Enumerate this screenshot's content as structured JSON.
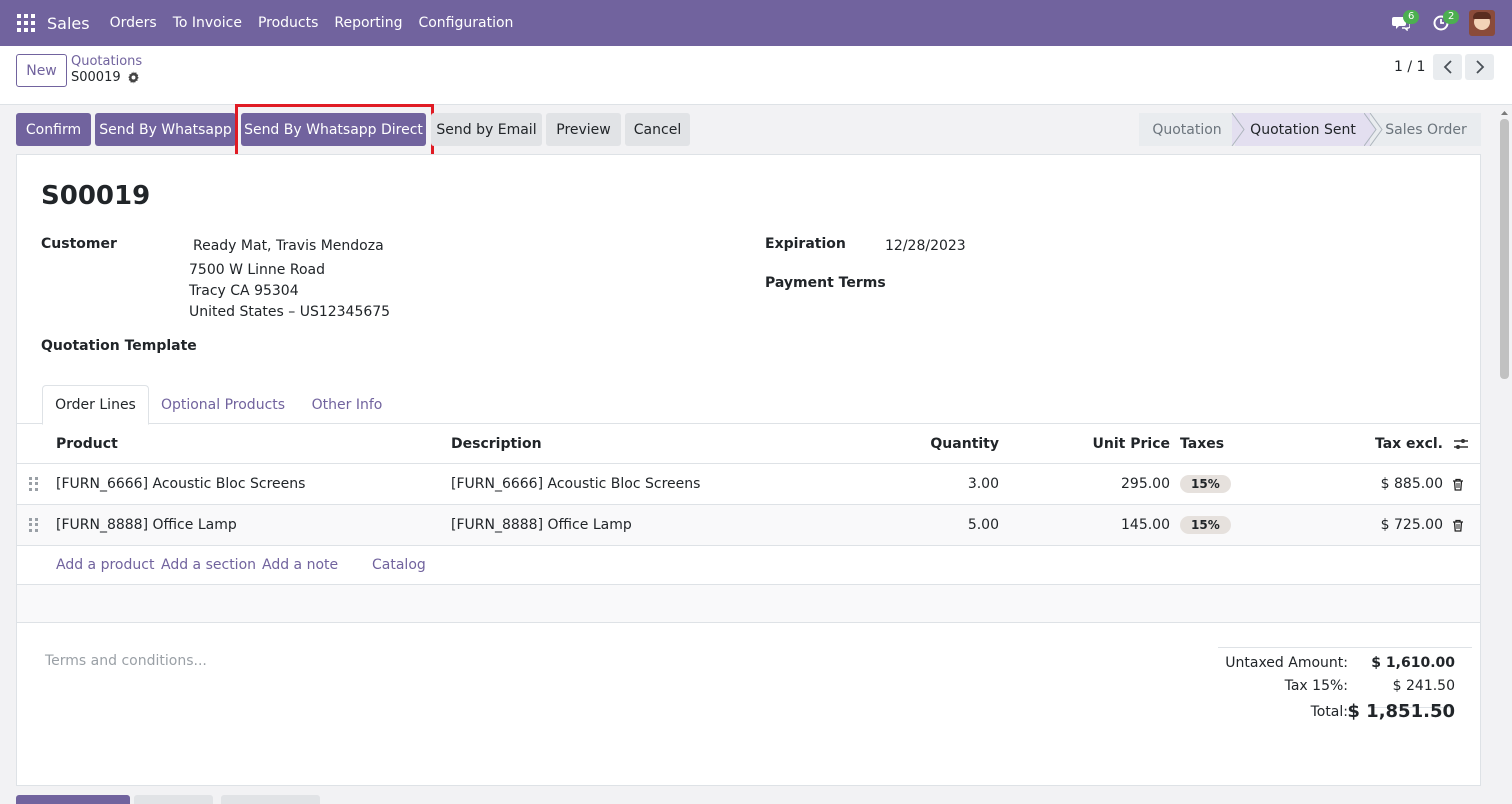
{
  "navbar": {
    "app_name": "Sales",
    "menus": [
      "Orders",
      "To Invoice",
      "Products",
      "Reporting",
      "Configuration"
    ],
    "messages_count": "6",
    "activities_count": "2"
  },
  "control_panel": {
    "new_label": "New",
    "breadcrumb_parent": "Quotations",
    "breadcrumb_current": "S00019",
    "pager": "1 / 1"
  },
  "actions": {
    "confirm": "Confirm",
    "send_whatsapp": "Send By Whatsapp",
    "send_whatsapp_direct": "Send By Whatsapp Direct",
    "send_email": "Send by Email",
    "preview": "Preview",
    "cancel": "Cancel"
  },
  "status": {
    "stages": [
      "Quotation",
      "Quotation Sent",
      "Sales Order"
    ],
    "active": "Quotation Sent"
  },
  "form": {
    "name": "S00019",
    "customer_label": "Customer",
    "customer_name": "Ready Mat, Travis Mendoza",
    "address_line1": "7500 W Linne Road",
    "address_line2": "Tracy CA 95304",
    "address_line3": "United States – US12345675",
    "expiration_label": "Expiration",
    "expiration_value": "12/28/2023",
    "payment_terms_label": "Payment Terms",
    "quotation_template_label": "Quotation Template"
  },
  "tabs": [
    "Order Lines",
    "Optional Products",
    "Other Info"
  ],
  "table": {
    "headers": {
      "product": "Product",
      "description": "Description",
      "quantity": "Quantity",
      "unit_price": "Unit Price",
      "taxes": "Taxes",
      "tax_excl": "Tax excl."
    },
    "rows": [
      {
        "product": "[FURN_6666] Acoustic Bloc Screens",
        "description": "[FURN_6666] Acoustic Bloc Screens",
        "quantity": "3.00",
        "unit_price": "295.00",
        "tax": "15%",
        "subtotal": "$ 885.00"
      },
      {
        "product": "[FURN_8888] Office Lamp",
        "description": "[FURN_8888] Office Lamp",
        "quantity": "5.00",
        "unit_price": "145.00",
        "tax": "15%",
        "subtotal": "$ 725.00"
      }
    ],
    "add_links": {
      "add_product": "Add a product",
      "add_section": "Add a section",
      "add_note": "Add a note",
      "catalog": "Catalog"
    }
  },
  "terms_placeholder": "Terms and conditions...",
  "totals": {
    "untaxed_label": "Untaxed Amount:",
    "untaxed_value": "$ 1,610.00",
    "tax_label": "Tax 15%:",
    "tax_value": "$ 241.50",
    "total_label": "Total:",
    "total_value": "$ 1,851.50"
  },
  "colors": {
    "brand": "#71639e",
    "highlight": "#e01b24",
    "badge": "#4caf50"
  }
}
